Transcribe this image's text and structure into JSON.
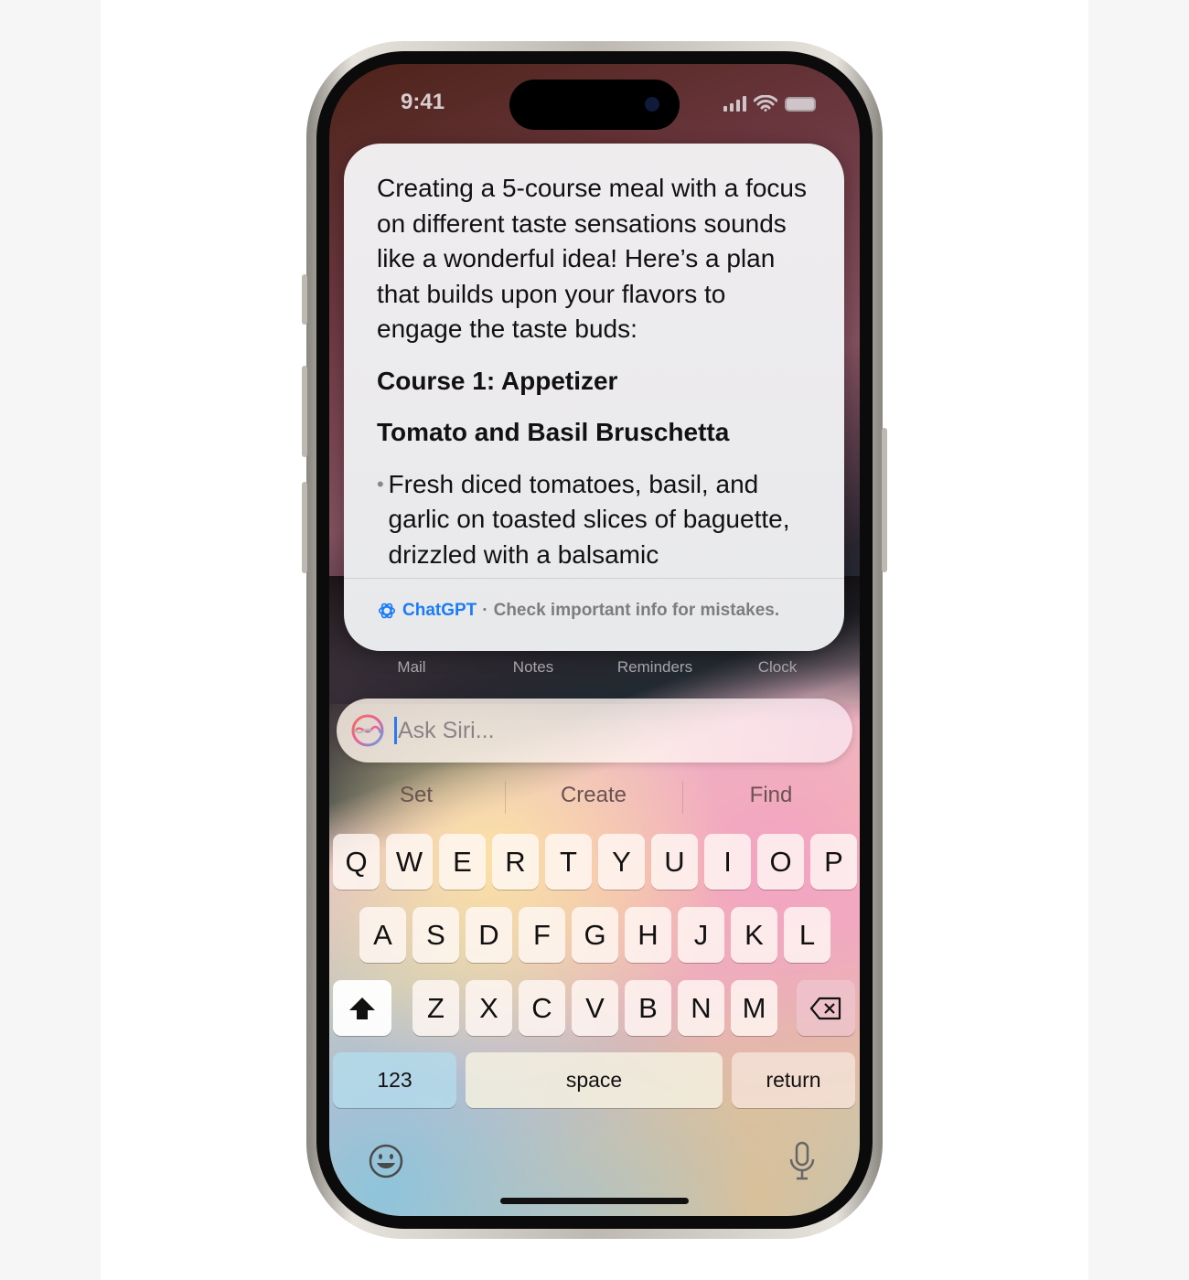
{
  "status_bar": {
    "time": "9:41",
    "icons": [
      "cellular-signal-icon",
      "wifi-icon",
      "battery-icon"
    ]
  },
  "response_card": {
    "intro": "Creating a 5-course meal with a focus on different taste sensations sounds like a wonderful idea! Here’s a plan that builds upon your flavors to engage the taste buds:",
    "heading1": "Course 1: Appetizer",
    "heading2": "Tomato and Basil Bruschetta",
    "bullets": [
      "Fresh diced tomatoes, basil, and garlic on toasted slices of baguette, drizzled with a balsamic"
    ],
    "footer": {
      "brand": "ChatGPT",
      "separator": "·",
      "note": "Check important info for mistakes.",
      "brand_color": "#1a7cf5"
    }
  },
  "app_labels": [
    "Mail",
    "Notes",
    "Reminders",
    "Clock"
  ],
  "siri_input": {
    "placeholder": "Ask Siri..."
  },
  "suggestions": [
    "Set",
    "Create",
    "Find"
  ],
  "keyboard": {
    "row1": [
      "Q",
      "W",
      "E",
      "R",
      "T",
      "Y",
      "U",
      "I",
      "O",
      "P"
    ],
    "row2": [
      "A",
      "S",
      "D",
      "F",
      "G",
      "H",
      "J",
      "K",
      "L"
    ],
    "row3": [
      "Z",
      "X",
      "C",
      "V",
      "B",
      "N",
      "M"
    ],
    "numbers": "123",
    "space": "space",
    "return": "return"
  }
}
